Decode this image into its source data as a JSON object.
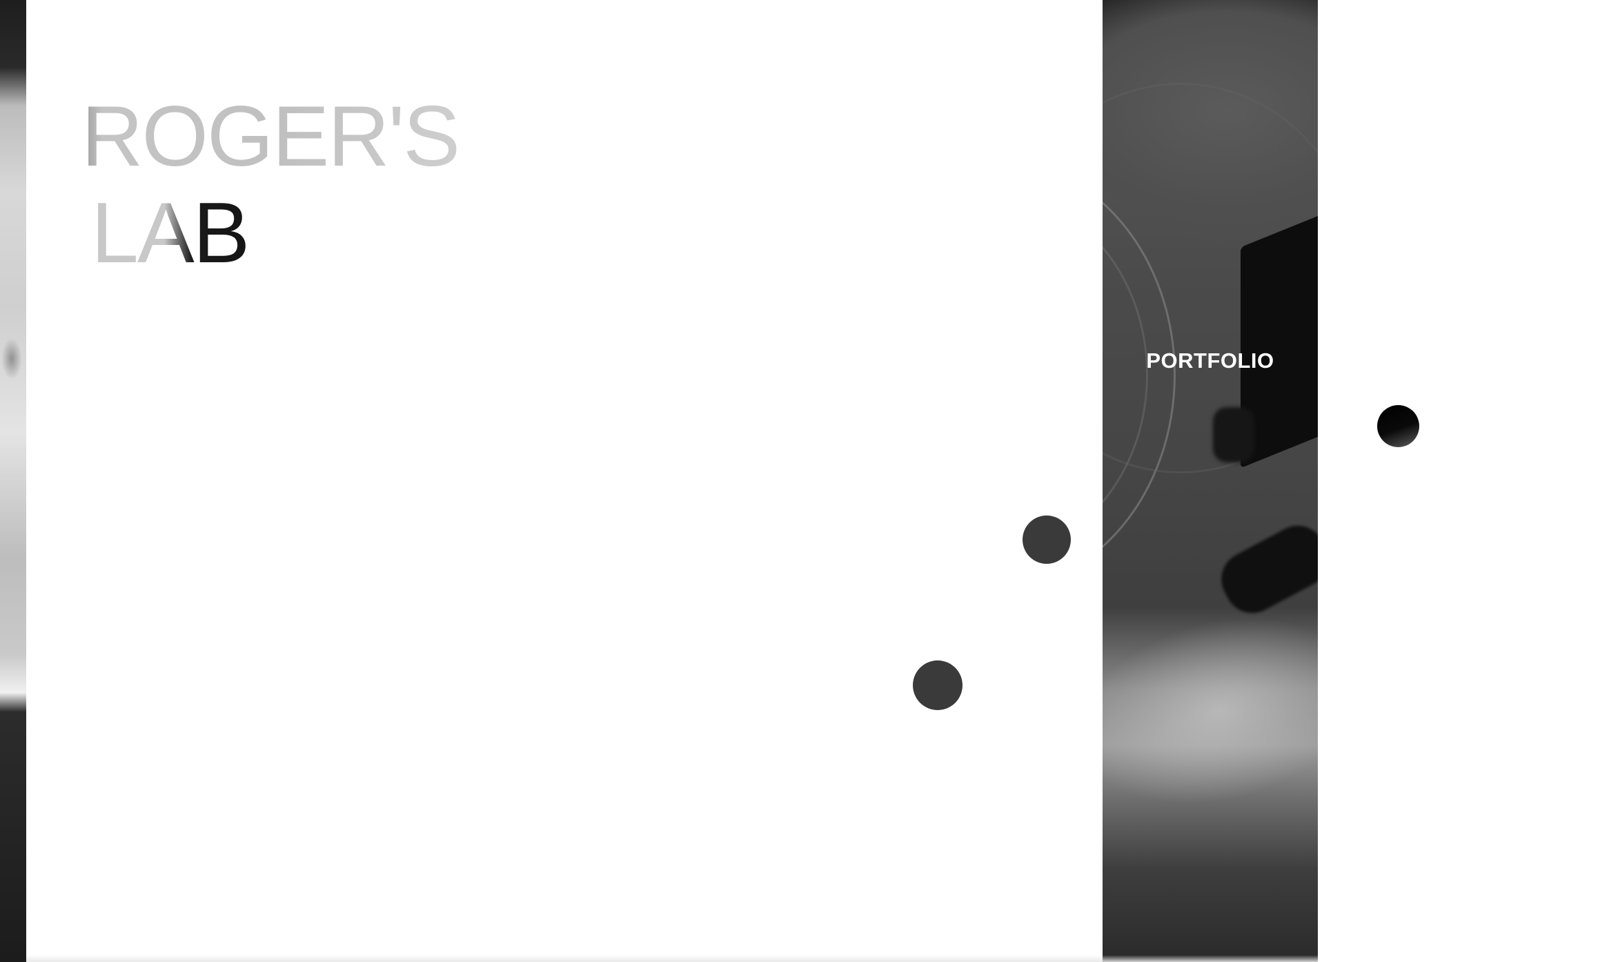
{
  "logo": {
    "line1": "ROGER'S",
    "line2": "LAB"
  },
  "nav": {
    "portfolio_label": "PORTFOLIO"
  },
  "colors": {
    "background": "#ffffff",
    "logo_gray": "#c4c4c4",
    "logo_dark": "#111111",
    "dot": "#3a3a3a",
    "nav_text": "#ffffff"
  }
}
